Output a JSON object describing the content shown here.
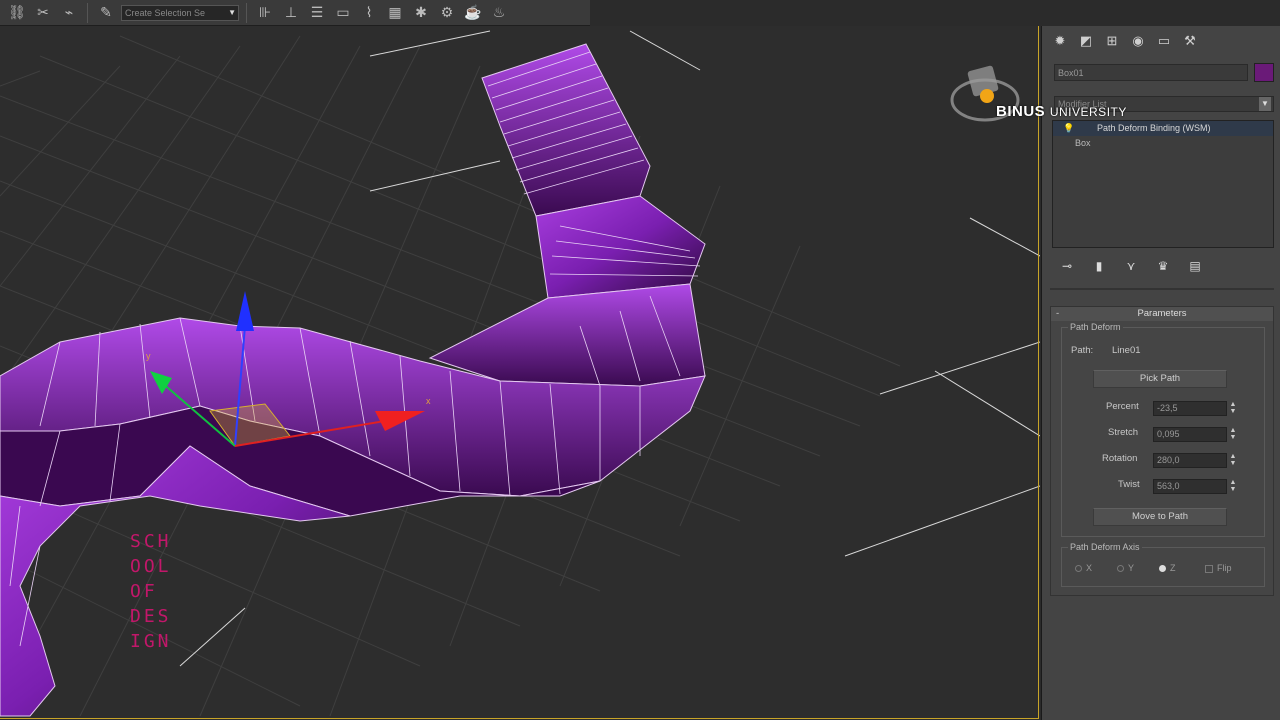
{
  "toolbar": {
    "selection_set_placeholder": "Create Selection Se",
    "icons": [
      "select-link-icon",
      "unlink-icon",
      "bind-spacewarp-icon",
      "selection-filter-icon",
      "named-sets-icon",
      "mirror-icon",
      "align-icon",
      "layer-manager-icon",
      "graphite-tools-icon",
      "curve-editor-icon",
      "schematic-view-icon",
      "material-editor-icon",
      "render-setup-icon",
      "rendered-frame-icon",
      "render-icon"
    ]
  },
  "viewport": {
    "watermark_school": [
      "SCH",
      "OOL",
      "OF",
      "DES",
      "IGN"
    ],
    "object_color": "#9b2fc4"
  },
  "brand": {
    "name_bold": "BINUS",
    "name_light": "UNIVERSITY"
  },
  "panel": {
    "tabs": [
      "create-tab",
      "modify-tab",
      "hierarchy-tab",
      "motion-tab",
      "display-tab",
      "utilities-tab"
    ],
    "object_name": "Box01",
    "object_color": "#6a1a78",
    "modifier_list": "Modifier List",
    "stack": [
      {
        "label": "Path Deform Binding (WSM)",
        "selected": true
      },
      {
        "label": "Box",
        "selected": false
      }
    ],
    "parameters": {
      "title": "Parameters",
      "path_deform_group": "Path Deform",
      "path_label": "Path:",
      "path_value": "Line01",
      "pick_path": "Pick Path",
      "percent_label": "Percent",
      "percent_value": "-23,5",
      "stretch_label": "Stretch",
      "stretch_value": "0,095",
      "rotation_label": "Rotation",
      "rotation_value": "280,0",
      "twist_label": "Twist",
      "twist_value": "563,0",
      "move_to_path": "Move to Path",
      "axis_group": "Path Deform Axis",
      "axis_x": "X",
      "axis_y": "Y",
      "axis_z": "Z",
      "axis_selected": "Z",
      "flip": "Flip"
    }
  }
}
